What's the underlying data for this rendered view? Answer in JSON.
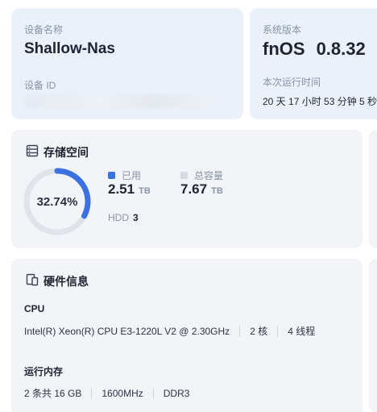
{
  "device": {
    "name_label": "设备名称",
    "name": "Shallow-Nas",
    "id_label": "设备 ID"
  },
  "system": {
    "version_label": "系统版本",
    "os_name": "fnOS",
    "os_version": "0.8.32",
    "uptime_label": "本次运行时间",
    "uptime": "20 天 17 小时 53 分钟 5 秒"
  },
  "storage": {
    "title": "存储空间",
    "usage_percent_text": "32.74%",
    "usage_fraction": 0.3274,
    "used_label": "已用",
    "used_value": "2.51",
    "used_unit": "TB",
    "total_label": "总容量",
    "total_value": "7.67",
    "total_unit": "TB",
    "disk_type": "HDD",
    "disk_count": "3",
    "colors": {
      "used": "#3a73e0",
      "track": "#dfe3ea"
    }
  },
  "hardware": {
    "title": "硬件信息",
    "cpu_label": "CPU",
    "cpu_model": "Intel(R) Xeon(R) CPU E3-1220L V2 @ 2.30GHz",
    "cpu_cores": "2 核",
    "cpu_threads": "4 线程",
    "memory_label": "运行内存",
    "memory_summary": "2 条共 16 GB",
    "memory_speed": "1600MHz",
    "memory_type": "DDR3"
  },
  "icons": {
    "storage": "storage-icon",
    "hardware": "hardware-icon"
  }
}
